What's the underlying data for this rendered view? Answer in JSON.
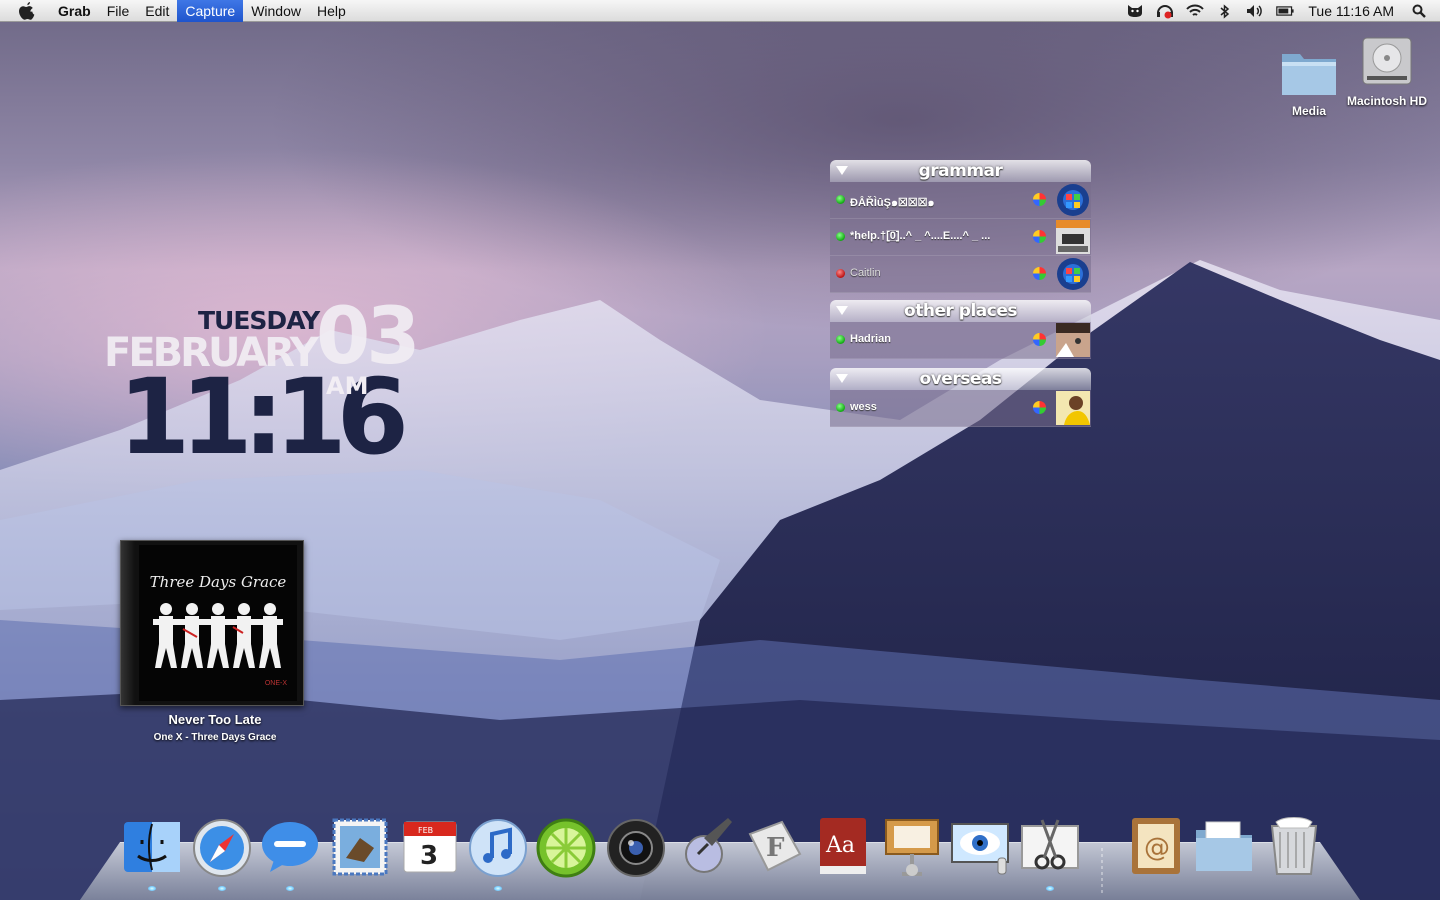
{
  "menubar": {
    "app_name": "Grab",
    "menus": [
      "File",
      "Edit",
      "Capture",
      "Window",
      "Help"
    ],
    "active_menu": "Capture",
    "clock": "Tue 11:16 AM"
  },
  "desktop_icons": [
    {
      "label": "Media",
      "icon": "folder-icon"
    },
    {
      "label": "Macintosh HD",
      "icon": "hard-drive-icon"
    }
  ],
  "clock_widget": {
    "day": "TUESDAY",
    "month": "FEBRUARY",
    "date": "03",
    "time": "11:16",
    "ampm": "AM"
  },
  "now_playing": {
    "song": "Never Too Late",
    "subtitle": "One X - Three Days Grace",
    "album_art_text": "Three Days Grace",
    "album_art_small": "ONE-X"
  },
  "buddy_list": {
    "groups": [
      {
        "name": "grammar",
        "buddies": [
          {
            "name": "ÐÅŘÌûŞ๑☒☒☒๑",
            "status": "online"
          },
          {
            "name": "*help.†[̲̅0̲̅]..^ _ ^....E....^ _   ...",
            "status": "online"
          },
          {
            "name": "Caitlin",
            "status": "away"
          }
        ]
      },
      {
        "name": "other places",
        "buddies": [
          {
            "name": "Hadrian",
            "status": "online"
          }
        ]
      },
      {
        "name": "overseas",
        "buddies": [
          {
            "name": "wess",
            "status": "online"
          }
        ]
      }
    ]
  },
  "dock": {
    "apps": [
      "finder-icon",
      "safari-icon",
      "ichat-icon",
      "mail-icon",
      "ical-icon",
      "itunes-icon",
      "limewire-icon",
      "aperture-icon",
      "script-editor-icon",
      "font-book-icon",
      "dictionary-icon",
      "keynote-icon",
      "preview-icon",
      "grab-icon"
    ],
    "stack": [
      "address-book-icon",
      "documents-folder-icon",
      "trash-icon"
    ],
    "calendar_month": "FEB",
    "calendar_day": "3"
  }
}
